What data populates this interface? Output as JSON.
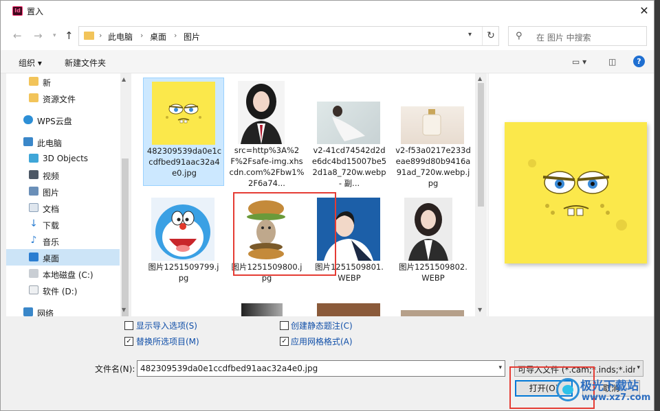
{
  "window": {
    "title": "置入",
    "app_icon": "Id"
  },
  "nav": {
    "breadcrumb": [
      "此电脑",
      "桌面",
      "图片"
    ],
    "search_placeholder": "在 图片 中搜索"
  },
  "toolbar": {
    "organize": "组织",
    "new_folder": "新建文件夹"
  },
  "sidebar": {
    "items": [
      {
        "label": "新",
        "icon": "folder-icon"
      },
      {
        "label": "资源文件",
        "icon": "folder-icon"
      },
      {
        "label": "WPS云盘",
        "icon": "cloud-icon"
      },
      {
        "label": "此电脑",
        "icon": "computer-icon"
      },
      {
        "label": "3D Objects",
        "icon": "cube-icon"
      },
      {
        "label": "视频",
        "icon": "video-icon"
      },
      {
        "label": "图片",
        "icon": "picture-icon"
      },
      {
        "label": "文档",
        "icon": "document-icon"
      },
      {
        "label": "下载",
        "icon": "download-icon"
      },
      {
        "label": "音乐",
        "icon": "music-icon"
      },
      {
        "label": "桌面",
        "icon": "desktop-icon"
      },
      {
        "label": "本地磁盘 (C:)",
        "icon": "drive-icon"
      },
      {
        "label": "软件 (D:)",
        "icon": "drive-icon"
      },
      {
        "label": "网络",
        "icon": "network-icon"
      }
    ]
  },
  "files": [
    {
      "name": "482309539da0e1ccdfbed91aac32a4e0.jpg"
    },
    {
      "name": "src=http%3A%2F%2Fsafe-img.xhscdn.com%2Fbw1%2F6a74..."
    },
    {
      "name": "v2-41cd74542d2de6dc4bd15007be52d1a8_720w.webp - 副..."
    },
    {
      "name": "v2-f53a0217e233deae899d80b9416a91ad_720w.webp.jpg"
    },
    {
      "name": "图片1251509799.jpg"
    },
    {
      "name": "图片1251509800.jpg"
    },
    {
      "name": "图片1251509801.WEBP"
    },
    {
      "name": "图片1251509802.WEBP"
    }
  ],
  "options": {
    "show_import_options": "显示导入选项(S)",
    "create_static_caption": "创建静态题注(C)",
    "replace_selected": "替换所选项目(M)",
    "apply_grid_format": "应用网格格式(A)",
    "show_import_checked": false,
    "create_static_checked": false,
    "replace_checked": true,
    "grid_checked": true
  },
  "filename": {
    "label": "文件名(N):",
    "value": "482309539da0e1ccdfbed91aac32a4e0.jpg"
  },
  "filter": {
    "value": "可导入文件 (*.cam;*.inds;*.idr"
  },
  "buttons": {
    "open": "打开(O)",
    "cancel": "取消"
  },
  "watermark": {
    "title": "极光下载站",
    "url": "www.xz7.com"
  },
  "colors": {
    "accent": "#0078d7",
    "highlight": "#e53b33",
    "selection": "#cce8ff"
  }
}
